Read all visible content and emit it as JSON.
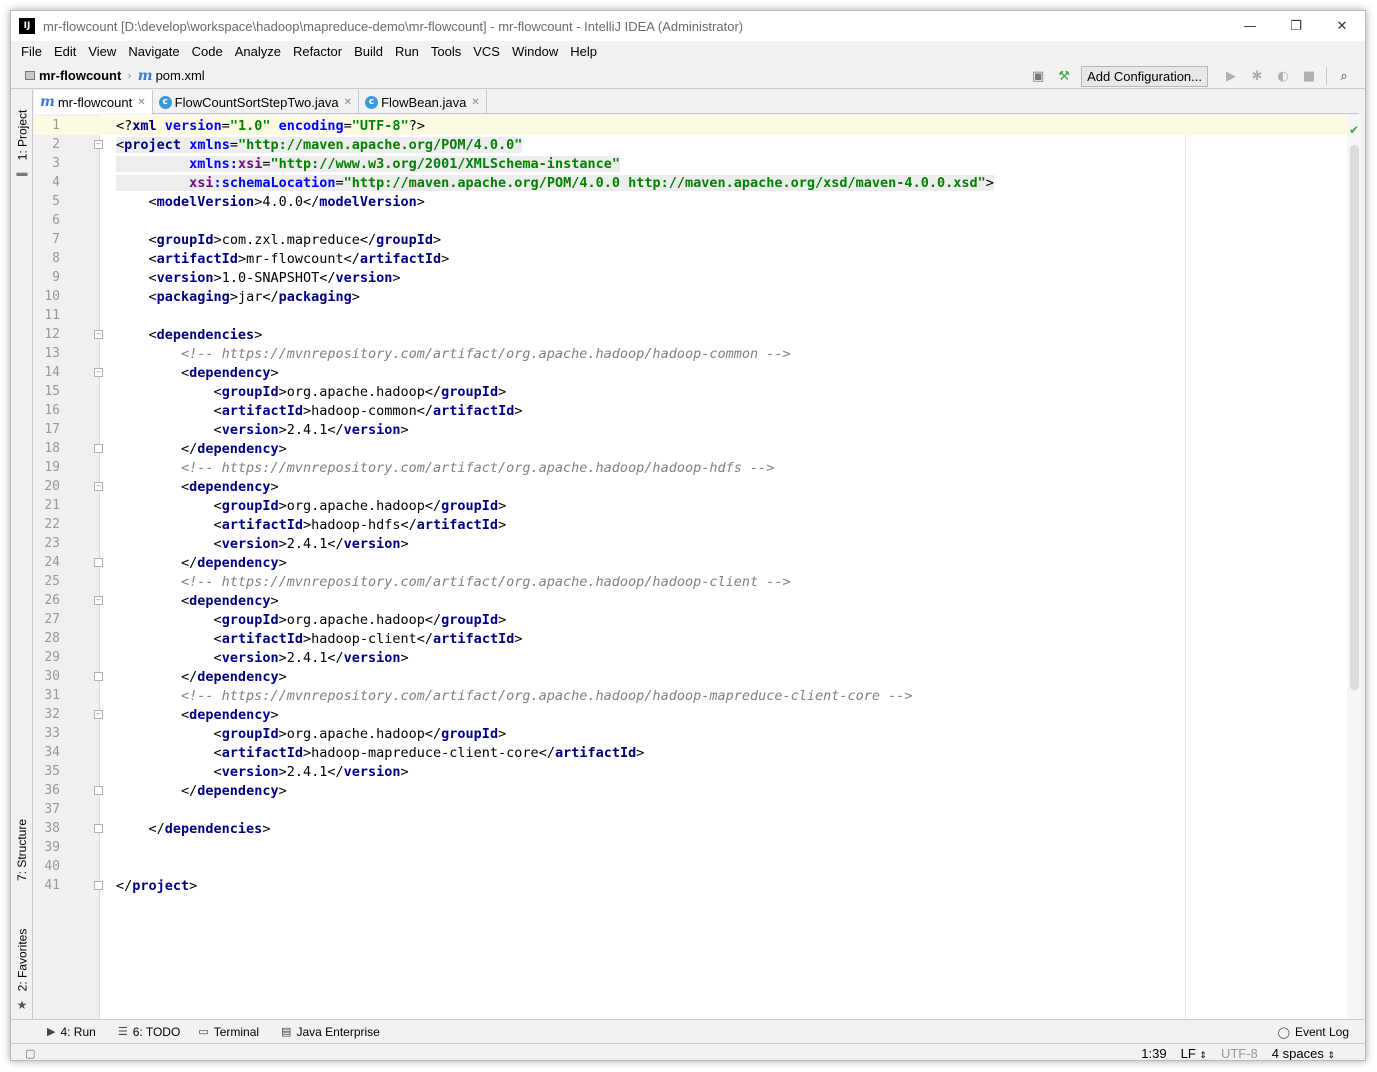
{
  "window": {
    "title": "mr-flowcount [D:\\develop\\workspace\\hadoop\\mapreduce-demo\\mr-flowcount] - mr-flowcount - IntelliJ IDEA (Administrator)",
    "app_icon_text": "IJ",
    "controls": {
      "minimize": "—",
      "restore": "❐",
      "close": "✕"
    }
  },
  "menu": [
    "File",
    "Edit",
    "View",
    "Navigate",
    "Code",
    "Analyze",
    "Refactor",
    "Build",
    "Run",
    "Tools",
    "VCS",
    "Window",
    "Help"
  ],
  "navbar": {
    "project": "mr-flowcount",
    "file": "pom.xml",
    "add_configuration": "Add Configuration..."
  },
  "tool_windows": {
    "left": [
      {
        "number": "1",
        "label": "1: Project"
      },
      {
        "number": "7",
        "label": "7: Structure"
      },
      {
        "number": "2",
        "label": "2: Favorites"
      }
    ],
    "bottom": [
      {
        "icon": "run-icon",
        "label": "4: Run"
      },
      {
        "icon": "todo-icon",
        "label": "6: TODO"
      },
      {
        "icon": "terminal-icon",
        "label": "Terminal"
      },
      {
        "icon": "java-enterprise-icon",
        "label": "Java Enterprise"
      }
    ],
    "event_log": "Event Log"
  },
  "tabs": [
    {
      "icon": "m",
      "label": "mr-flowcount",
      "active": true
    },
    {
      "icon": "c",
      "label": "FlowCountSortStepTwo.java",
      "active": false
    },
    {
      "icon": "c",
      "label": "FlowBean.java",
      "active": false
    }
  ],
  "editor": {
    "lines": [
      "<?xml version=\"1.0\" encoding=\"UTF-8\"?>",
      "<project xmlns=\"http://maven.apache.org/POM/4.0.0\"",
      "         xmlns:xsi=\"http://www.w3.org/2001/XMLSchema-instance\"",
      "         xsi:schemaLocation=\"http://maven.apache.org/POM/4.0.0 http://maven.apache.org/xsd/maven-4.0.0.xsd\">",
      "    <modelVersion>4.0.0</modelVersion>",
      "",
      "    <groupId>com.zxl.mapreduce</groupId>",
      "    <artifactId>mr-flowcount</artifactId>",
      "    <version>1.0-SNAPSHOT</version>",
      "    <packaging>jar</packaging>",
      "",
      "    <dependencies>",
      "        <!-- https://mvnrepository.com/artifact/org.apache.hadoop/hadoop-common -->",
      "        <dependency>",
      "            <groupId>org.apache.hadoop</groupId>",
      "            <artifactId>hadoop-common</artifactId>",
      "            <version>2.4.1</version>",
      "        </dependency>",
      "        <!-- https://mvnrepository.com/artifact/org.apache.hadoop/hadoop-hdfs -->",
      "        <dependency>",
      "            <groupId>org.apache.hadoop</groupId>",
      "            <artifactId>hadoop-hdfs</artifactId>",
      "            <version>2.4.1</version>",
      "        </dependency>",
      "        <!-- https://mvnrepository.com/artifact/org.apache.hadoop/hadoop-client -->",
      "        <dependency>",
      "            <groupId>org.apache.hadoop</groupId>",
      "            <artifactId>hadoop-client</artifactId>",
      "            <version>2.4.1</version>",
      "        </dependency>",
      "        <!-- https://mvnrepository.com/artifact/org.apache.hadoop/hadoop-mapreduce-client-core -->",
      "        <dependency>",
      "            <groupId>org.apache.hadoop</groupId>",
      "            <artifactId>hadoop-mapreduce-client-core</artifactId>",
      "            <version>2.4.1</version>",
      "        </dependency>",
      "",
      "    </dependencies>",
      "",
      "",
      "</project>"
    ],
    "fold_lines": [
      2,
      12,
      14,
      18,
      20,
      24,
      26,
      30,
      32,
      36,
      38,
      41
    ]
  },
  "status": {
    "position": "1:39",
    "line_separator": "LF",
    "encoding": "UTF-8",
    "indent": "4 spaces"
  },
  "colors": {
    "tag": "#000080",
    "attribute": "#0000ff",
    "namespace": "#660e7a",
    "value": "#008000",
    "comment": "#808080",
    "current_line": "#fcfae1"
  }
}
